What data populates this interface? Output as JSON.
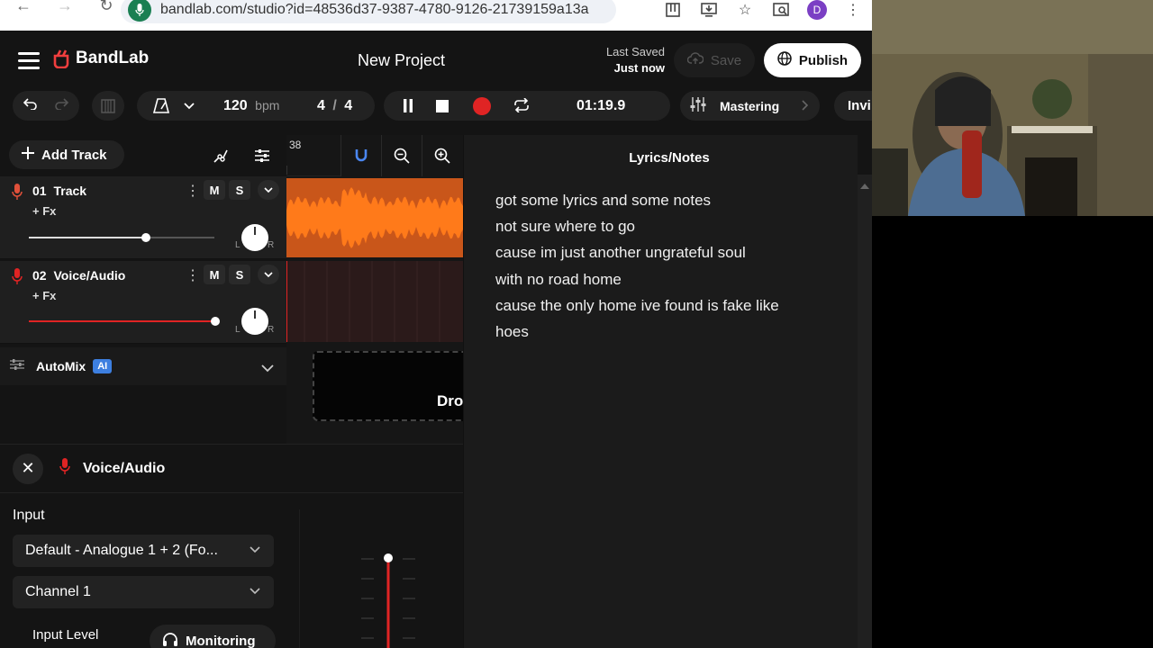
{
  "browser": {
    "url": "bandlab.com/studio?id=48536d37-9387-4780-9126-21739159a13a",
    "avatar_letter": "D"
  },
  "header": {
    "logo_text": "BandLab",
    "project_title": "New Project",
    "last_saved_label": "Last Saved",
    "last_saved_value": "Just now",
    "save_label": "Save",
    "publish_label": "Publish"
  },
  "transport": {
    "tempo_value": "120",
    "tempo_unit": "bpm",
    "time_sig_num": "4",
    "time_sig_sep": "/",
    "time_sig_den": "4",
    "time": "01:19.9",
    "mastering_label": "Mastering",
    "invite_label": "Invi"
  },
  "tracks_panel": {
    "add_track_label": "Add Track",
    "ruler_bar": "38",
    "tracks": [
      {
        "number": "01",
        "name": "Track",
        "fx": "+ Fx",
        "mute": "M",
        "solo": "S",
        "l": "L",
        "r": "R",
        "volume": 0.55
      },
      {
        "number": "02",
        "name": "Voice/Audio",
        "fx": "+ Fx",
        "mute": "M",
        "solo": "S",
        "l": "L",
        "r": "R",
        "volume": 0.95
      }
    ],
    "automix_label": "AutoMix",
    "automix_badge": "AI",
    "drop_text": "Dro"
  },
  "bottom_panel": {
    "title": "Voice/Audio",
    "input_label": "Input",
    "input_device": "Default - Analogue 1 + 2 (Fo...",
    "channel": "Channel 1",
    "input_level_label": "Input Level",
    "monitoring_label": "Monitoring"
  },
  "lyrics": {
    "title": "Lyrics/Notes",
    "lines": [
      "got some lyrics and some notes",
      "not sure where to go",
      "cause im just another ungrateful soul",
      "with no road home",
      "cause the only home ive found is fake like",
      "hoes"
    ]
  },
  "colors": {
    "accent_red": "#e02424",
    "waveform_orange": "#ff7a1a",
    "clip_orange": "#c9561a",
    "ai_blue": "#3d7fe0",
    "publish_bg": "#ffffff"
  }
}
